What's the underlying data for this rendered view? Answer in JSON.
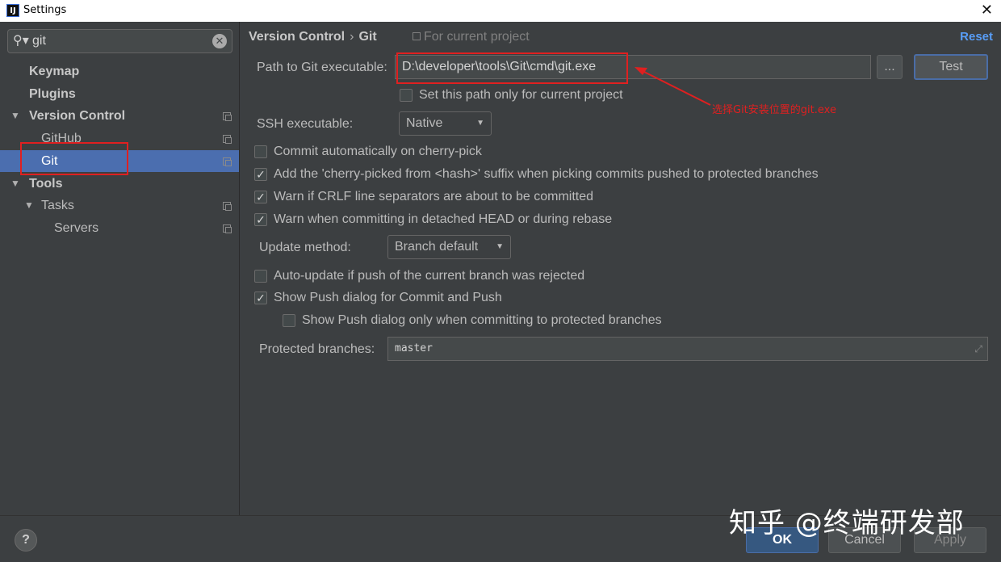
{
  "window": {
    "title": "Settings",
    "app_icon": "IJ"
  },
  "search": {
    "value": "git"
  },
  "tree": {
    "keymap": "Keymap",
    "plugins": "Plugins",
    "version_control": "Version Control",
    "github": "GitHub",
    "git": "Git",
    "tools": "Tools",
    "tasks": "Tasks",
    "servers": "Servers"
  },
  "header": {
    "crumb_parent": "Version Control",
    "crumb_sep": "›",
    "crumb_current": "Git",
    "scope": "For current project",
    "reset": "Reset"
  },
  "form": {
    "path_label": "Path to Git executable:",
    "path_value": "D:\\developer\\tools\\Git\\cmd\\git.exe",
    "browse": "...",
    "test": "Test",
    "path_only_current": "Set this path only for current project",
    "ssh_label": "SSH executable:",
    "ssh_value": "Native",
    "commit_cherry": "Commit automatically on cherry-pick",
    "add_suffix": "Add the 'cherry-picked from <hash>' suffix when picking commits pushed to protected branches",
    "warn_crlf": "Warn if CRLF line separators are about to be committed",
    "warn_detached": "Warn when committing in detached HEAD or during rebase",
    "update_label": "Update method:",
    "update_value": "Branch default",
    "auto_update": "Auto-update if push of the current branch was rejected",
    "show_push": "Show Push dialog for Commit and Push",
    "show_push_protected": "Show Push dialog only when committing to protected branches",
    "protected_label": "Protected branches:",
    "protected_value": "master"
  },
  "checkbox_states": {
    "path_only_current": false,
    "commit_cherry": false,
    "add_suffix": true,
    "warn_crlf": true,
    "warn_detached": true,
    "auto_update": false,
    "show_push": true,
    "show_push_protected": false
  },
  "annotation": {
    "text": "选择Git安装位置的git.exe",
    "color": "#e02020"
  },
  "footer": {
    "help": "?",
    "ok": "OK",
    "cancel": "Cancel",
    "apply": "Apply"
  },
  "watermark": "知乎 @终端研发部",
  "colors": {
    "accent": "#4b6eaf",
    "link": "#589df6",
    "background": "#3c3f41"
  }
}
